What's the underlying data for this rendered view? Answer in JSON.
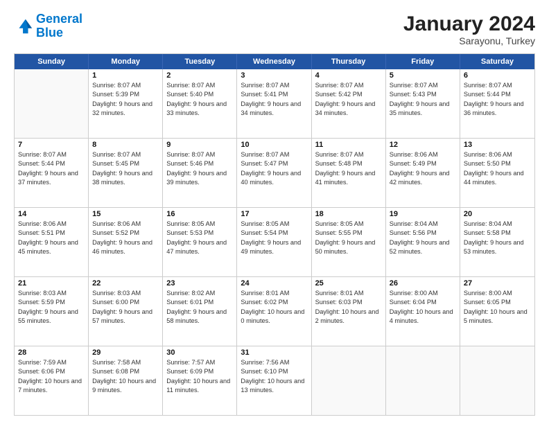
{
  "header": {
    "logo": {
      "line1": "General",
      "line2": "Blue"
    },
    "month": "January 2024",
    "location": "Sarayonu, Turkey"
  },
  "weekdays": [
    "Sunday",
    "Monday",
    "Tuesday",
    "Wednesday",
    "Thursday",
    "Friday",
    "Saturday"
  ],
  "rows": [
    [
      {
        "day": "",
        "sunrise": "",
        "sunset": "",
        "daylight": "",
        "empty": true
      },
      {
        "day": "1",
        "sunrise": "Sunrise: 8:07 AM",
        "sunset": "Sunset: 5:39 PM",
        "daylight": "Daylight: 9 hours and 32 minutes."
      },
      {
        "day": "2",
        "sunrise": "Sunrise: 8:07 AM",
        "sunset": "Sunset: 5:40 PM",
        "daylight": "Daylight: 9 hours and 33 minutes."
      },
      {
        "day": "3",
        "sunrise": "Sunrise: 8:07 AM",
        "sunset": "Sunset: 5:41 PM",
        "daylight": "Daylight: 9 hours and 34 minutes."
      },
      {
        "day": "4",
        "sunrise": "Sunrise: 8:07 AM",
        "sunset": "Sunset: 5:42 PM",
        "daylight": "Daylight: 9 hours and 34 minutes."
      },
      {
        "day": "5",
        "sunrise": "Sunrise: 8:07 AM",
        "sunset": "Sunset: 5:43 PM",
        "daylight": "Daylight: 9 hours and 35 minutes."
      },
      {
        "day": "6",
        "sunrise": "Sunrise: 8:07 AM",
        "sunset": "Sunset: 5:44 PM",
        "daylight": "Daylight: 9 hours and 36 minutes."
      }
    ],
    [
      {
        "day": "7",
        "sunrise": "Sunrise: 8:07 AM",
        "sunset": "Sunset: 5:44 PM",
        "daylight": "Daylight: 9 hours and 37 minutes."
      },
      {
        "day": "8",
        "sunrise": "Sunrise: 8:07 AM",
        "sunset": "Sunset: 5:45 PM",
        "daylight": "Daylight: 9 hours and 38 minutes."
      },
      {
        "day": "9",
        "sunrise": "Sunrise: 8:07 AM",
        "sunset": "Sunset: 5:46 PM",
        "daylight": "Daylight: 9 hours and 39 minutes."
      },
      {
        "day": "10",
        "sunrise": "Sunrise: 8:07 AM",
        "sunset": "Sunset: 5:47 PM",
        "daylight": "Daylight: 9 hours and 40 minutes."
      },
      {
        "day": "11",
        "sunrise": "Sunrise: 8:07 AM",
        "sunset": "Sunset: 5:48 PM",
        "daylight": "Daylight: 9 hours and 41 minutes."
      },
      {
        "day": "12",
        "sunrise": "Sunrise: 8:06 AM",
        "sunset": "Sunset: 5:49 PM",
        "daylight": "Daylight: 9 hours and 42 minutes."
      },
      {
        "day": "13",
        "sunrise": "Sunrise: 8:06 AM",
        "sunset": "Sunset: 5:50 PM",
        "daylight": "Daylight: 9 hours and 44 minutes."
      }
    ],
    [
      {
        "day": "14",
        "sunrise": "Sunrise: 8:06 AM",
        "sunset": "Sunset: 5:51 PM",
        "daylight": "Daylight: 9 hours and 45 minutes."
      },
      {
        "day": "15",
        "sunrise": "Sunrise: 8:06 AM",
        "sunset": "Sunset: 5:52 PM",
        "daylight": "Daylight: 9 hours and 46 minutes."
      },
      {
        "day": "16",
        "sunrise": "Sunrise: 8:05 AM",
        "sunset": "Sunset: 5:53 PM",
        "daylight": "Daylight: 9 hours and 47 minutes."
      },
      {
        "day": "17",
        "sunrise": "Sunrise: 8:05 AM",
        "sunset": "Sunset: 5:54 PM",
        "daylight": "Daylight: 9 hours and 49 minutes."
      },
      {
        "day": "18",
        "sunrise": "Sunrise: 8:05 AM",
        "sunset": "Sunset: 5:55 PM",
        "daylight": "Daylight: 9 hours and 50 minutes."
      },
      {
        "day": "19",
        "sunrise": "Sunrise: 8:04 AM",
        "sunset": "Sunset: 5:56 PM",
        "daylight": "Daylight: 9 hours and 52 minutes."
      },
      {
        "day": "20",
        "sunrise": "Sunrise: 8:04 AM",
        "sunset": "Sunset: 5:58 PM",
        "daylight": "Daylight: 9 hours and 53 minutes."
      }
    ],
    [
      {
        "day": "21",
        "sunrise": "Sunrise: 8:03 AM",
        "sunset": "Sunset: 5:59 PM",
        "daylight": "Daylight: 9 hours and 55 minutes."
      },
      {
        "day": "22",
        "sunrise": "Sunrise: 8:03 AM",
        "sunset": "Sunset: 6:00 PM",
        "daylight": "Daylight: 9 hours and 57 minutes."
      },
      {
        "day": "23",
        "sunrise": "Sunrise: 8:02 AM",
        "sunset": "Sunset: 6:01 PM",
        "daylight": "Daylight: 9 hours and 58 minutes."
      },
      {
        "day": "24",
        "sunrise": "Sunrise: 8:01 AM",
        "sunset": "Sunset: 6:02 PM",
        "daylight": "Daylight: 10 hours and 0 minutes."
      },
      {
        "day": "25",
        "sunrise": "Sunrise: 8:01 AM",
        "sunset": "Sunset: 6:03 PM",
        "daylight": "Daylight: 10 hours and 2 minutes."
      },
      {
        "day": "26",
        "sunrise": "Sunrise: 8:00 AM",
        "sunset": "Sunset: 6:04 PM",
        "daylight": "Daylight: 10 hours and 4 minutes."
      },
      {
        "day": "27",
        "sunrise": "Sunrise: 8:00 AM",
        "sunset": "Sunset: 6:05 PM",
        "daylight": "Daylight: 10 hours and 5 minutes."
      }
    ],
    [
      {
        "day": "28",
        "sunrise": "Sunrise: 7:59 AM",
        "sunset": "Sunset: 6:06 PM",
        "daylight": "Daylight: 10 hours and 7 minutes."
      },
      {
        "day": "29",
        "sunrise": "Sunrise: 7:58 AM",
        "sunset": "Sunset: 6:08 PM",
        "daylight": "Daylight: 10 hours and 9 minutes."
      },
      {
        "day": "30",
        "sunrise": "Sunrise: 7:57 AM",
        "sunset": "Sunset: 6:09 PM",
        "daylight": "Daylight: 10 hours and 11 minutes."
      },
      {
        "day": "31",
        "sunrise": "Sunrise: 7:56 AM",
        "sunset": "Sunset: 6:10 PM",
        "daylight": "Daylight: 10 hours and 13 minutes."
      },
      {
        "day": "",
        "sunrise": "",
        "sunset": "",
        "daylight": "",
        "empty": true
      },
      {
        "day": "",
        "sunrise": "",
        "sunset": "",
        "daylight": "",
        "empty": true
      },
      {
        "day": "",
        "sunrise": "",
        "sunset": "",
        "daylight": "",
        "empty": true
      }
    ]
  ]
}
